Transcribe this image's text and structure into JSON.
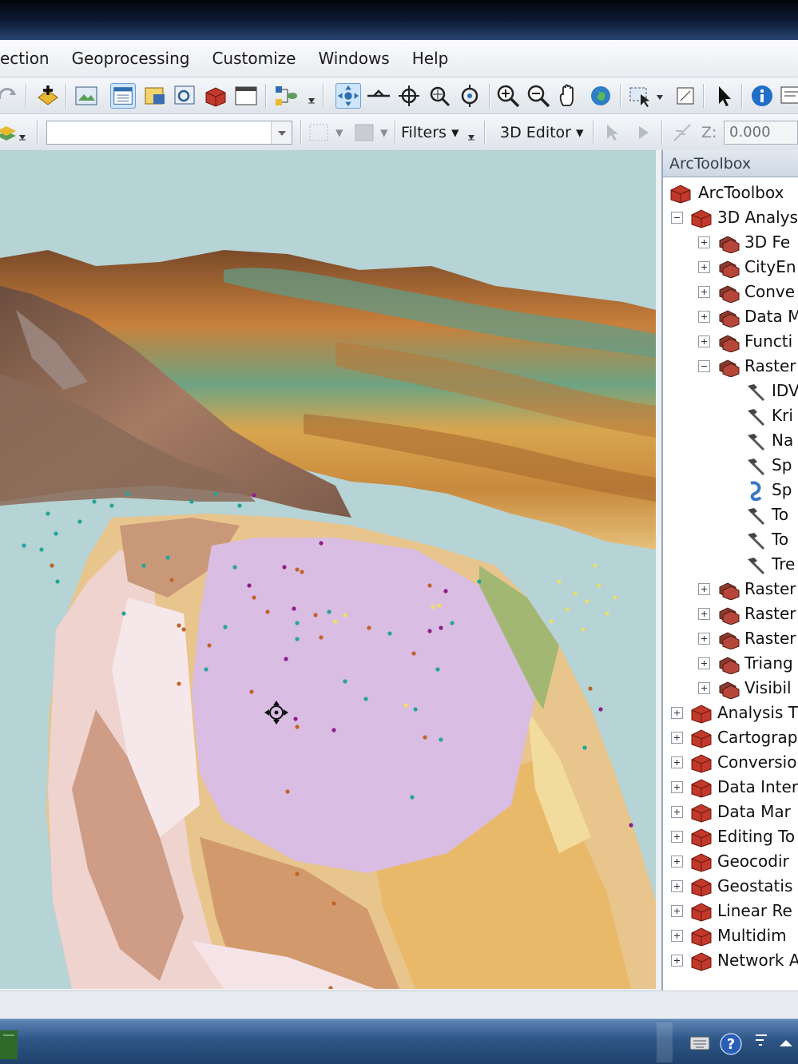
{
  "menubar": {
    "items": [
      "ection",
      "Geoprocessing",
      "Customize",
      "Windows",
      "Help"
    ]
  },
  "toolbar2": {
    "filters_label": "Filters ▾",
    "editor_label": "3D Editor ▾",
    "z_label": "Z:",
    "z_value": "0.000"
  },
  "toolbox": {
    "caption": "ArcToolbox",
    "root": "ArcToolbox",
    "tree": [
      {
        "level": 1,
        "toggle": "minus",
        "icon": "toolbox",
        "label": "3D Analys"
      },
      {
        "level": 2,
        "toggle": "plus",
        "icon": "toolset",
        "label": "3D Fe"
      },
      {
        "level": 2,
        "toggle": "plus",
        "icon": "toolset",
        "label": "CityEn"
      },
      {
        "level": 2,
        "toggle": "plus",
        "icon": "toolset",
        "label": "Conve"
      },
      {
        "level": 2,
        "toggle": "plus",
        "icon": "toolset",
        "label": "Data M"
      },
      {
        "level": 2,
        "toggle": "plus",
        "icon": "toolset",
        "label": "Functi"
      },
      {
        "level": 2,
        "toggle": "minus",
        "icon": "toolset",
        "label": "Raster"
      },
      {
        "level": 3,
        "toggle": "",
        "icon": "tool",
        "label": "IDV"
      },
      {
        "level": 3,
        "toggle": "",
        "icon": "tool",
        "label": "Kri"
      },
      {
        "level": 3,
        "toggle": "",
        "icon": "tool",
        "label": "Na"
      },
      {
        "level": 3,
        "toggle": "",
        "icon": "tool",
        "label": "Sp"
      },
      {
        "level": 3,
        "toggle": "",
        "icon": "script",
        "label": "Sp"
      },
      {
        "level": 3,
        "toggle": "",
        "icon": "tool",
        "label": "To"
      },
      {
        "level": 3,
        "toggle": "",
        "icon": "tool",
        "label": "To"
      },
      {
        "level": 3,
        "toggle": "",
        "icon": "tool",
        "label": "Tre"
      },
      {
        "level": 2,
        "toggle": "plus",
        "icon": "toolset",
        "label": "Raster"
      },
      {
        "level": 2,
        "toggle": "plus",
        "icon": "toolset",
        "label": "Raster"
      },
      {
        "level": 2,
        "toggle": "plus",
        "icon": "toolset",
        "label": "Raster"
      },
      {
        "level": 2,
        "toggle": "plus",
        "icon": "toolset",
        "label": "Triang"
      },
      {
        "level": 2,
        "toggle": "plus",
        "icon": "toolset",
        "label": "Visibil"
      },
      {
        "level": 1,
        "toggle": "plus",
        "icon": "toolbox",
        "label": "Analysis T"
      },
      {
        "level": 1,
        "toggle": "plus",
        "icon": "toolbox",
        "label": "Cartograp"
      },
      {
        "level": 1,
        "toggle": "plus",
        "icon": "toolbox",
        "label": "Conversio"
      },
      {
        "level": 1,
        "toggle": "plus",
        "icon": "toolbox",
        "label": "Data Inter"
      },
      {
        "level": 1,
        "toggle": "plus",
        "icon": "toolbox",
        "label": "Data Mar"
      },
      {
        "level": 1,
        "toggle": "plus",
        "icon": "toolbox",
        "label": "Editing To"
      },
      {
        "level": 1,
        "toggle": "plus",
        "icon": "toolbox",
        "label": "Geocodir"
      },
      {
        "level": 1,
        "toggle": "plus",
        "icon": "toolbox",
        "label": "Geostatis"
      },
      {
        "level": 1,
        "toggle": "plus",
        "icon": "toolbox",
        "label": "Linear Re"
      },
      {
        "level": 1,
        "toggle": "plus",
        "icon": "toolbox",
        "label": "Multidim"
      },
      {
        "level": 1,
        "toggle": "plus",
        "icon": "toolbox",
        "label": "Network A"
      }
    ]
  },
  "colors": {
    "map_background": "#b6d3d5",
    "polygon_purple": "#d9bde3",
    "terrain_tan": "#e8c58c",
    "point_teal": "#22a59a",
    "point_purple": "#8b1f8c",
    "point_orange": "#c0642a",
    "point_yellow": "#f0e060",
    "toolbox_red": "#c0392b"
  },
  "icons": {
    "taskbar": [
      "keyboard-icon",
      "help-icon",
      "network-icon",
      "show-hidden-icon"
    ]
  }
}
